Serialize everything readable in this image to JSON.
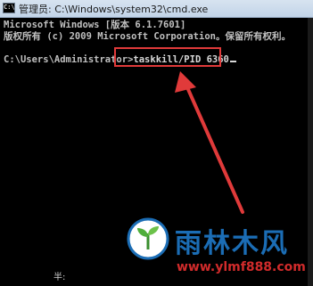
{
  "window": {
    "icon_label": "C:\\",
    "title": "管理员: C:\\Windows\\system32\\cmd.exe"
  },
  "console": {
    "line1": "Microsoft Windows [版本 6.1.7601]",
    "line2": "版权所有 (c) 2009 Microsoft Corporation。保留所有权利。",
    "prompt": "C:\\Users\\Administrator>",
    "command": "taskkill/PID 6360"
  },
  "ime_status": "半:",
  "watermark": {
    "title": "雨林木风",
    "url": "www.ylmf888.com"
  },
  "colors": {
    "highlight": "#e03a3a",
    "brand_blue": "#1b6db5",
    "brand_red": "#d12b2b"
  }
}
